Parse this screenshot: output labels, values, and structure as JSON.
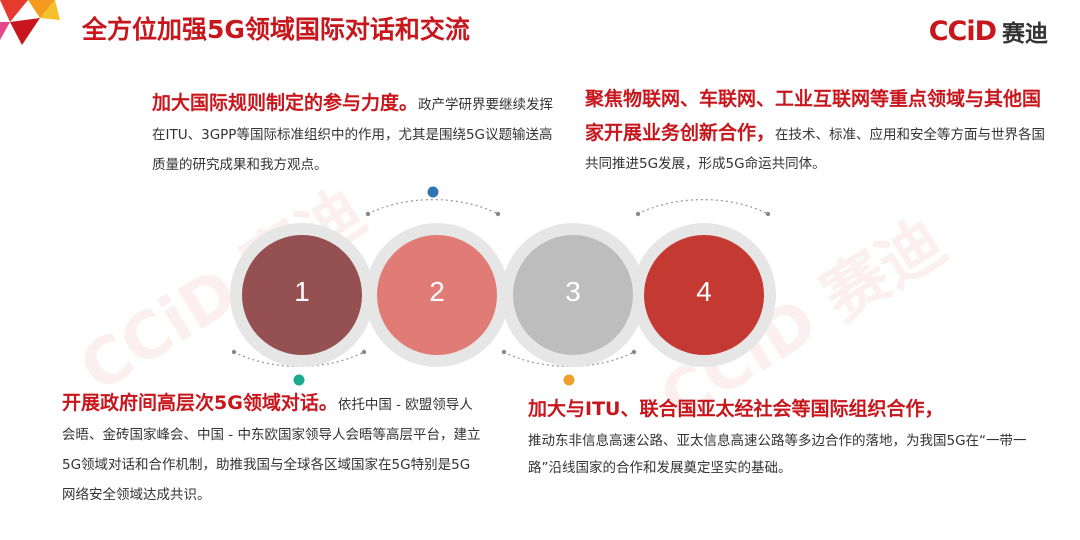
{
  "header": {
    "title": "全方位加强5G领域国际对话和交流",
    "logo_mark": "CCiD",
    "logo_cn": "赛迪"
  },
  "watermark": "CCiD 赛迪",
  "circles": [
    {
      "number": "1",
      "color": "#955151"
    },
    {
      "number": "2",
      "color": "#e07b76"
    },
    {
      "number": "3",
      "color": "#bdbdbd"
    },
    {
      "number": "4",
      "color": "#c43a32"
    }
  ],
  "dot_colors": [
    "#2f75b5",
    "#1aaa8e",
    "#f0a02a"
  ],
  "blocks": {
    "b1": {
      "lead": "加大国际规则制定的参与力度。",
      "body": "政产学研界要继续发挥在ITU、3GPP等国际标准组织中的作用，尤其是围绕5G议题输送高质量的研究成果和我方观点。"
    },
    "b2": {
      "lead": "聚焦物联网、车联网、工业互联网等重点领域与其他国家开展业务创新合作，",
      "body": "在技术、标准、应用和安全等方面与世界各国共同推进5G发展，形成5G命运共同体。"
    },
    "b3": {
      "lead": "开展政府间高层次5G领域对话。",
      "body": "依托中国 - 欧盟领导人会晤、金砖国家峰会、中国 - 中东欧国家领导人会晤等高层平台，建立5G领域对话和合作机制，助推我国与全球各区域国家在5G特别是5G网络安全领域达成共识。"
    },
    "b4": {
      "lead": "加大与ITU、联合国亚太经社会等国际组织合作，",
      "body": "推动东非信息高速公路、亚太信息高速公路等多边合作的落地，为我国5G在“一带一路”沿线国家的合作和发展奠定坚实的基础。"
    }
  }
}
